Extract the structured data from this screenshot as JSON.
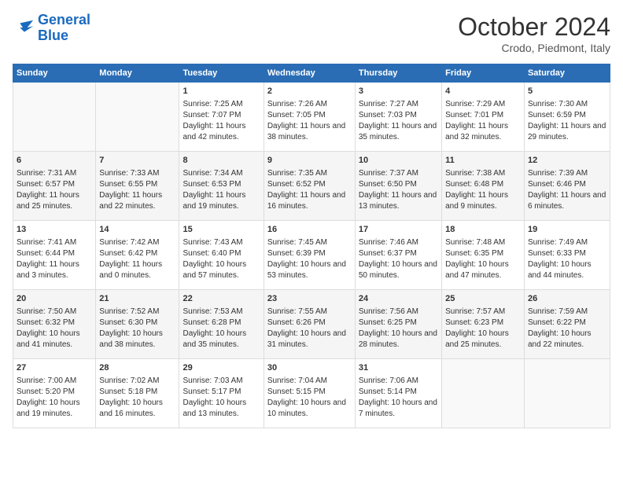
{
  "logo": {
    "line1": "General",
    "line2": "Blue"
  },
  "title": "October 2024",
  "location": "Crodo, Piedmont, Italy",
  "days_of_week": [
    "Sunday",
    "Monday",
    "Tuesday",
    "Wednesday",
    "Thursday",
    "Friday",
    "Saturday"
  ],
  "weeks": [
    [
      {
        "day": "",
        "info": ""
      },
      {
        "day": "",
        "info": ""
      },
      {
        "day": "1",
        "info": "Sunrise: 7:25 AM\nSunset: 7:07 PM\nDaylight: 11 hours and 42 minutes."
      },
      {
        "day": "2",
        "info": "Sunrise: 7:26 AM\nSunset: 7:05 PM\nDaylight: 11 hours and 38 minutes."
      },
      {
        "day": "3",
        "info": "Sunrise: 7:27 AM\nSunset: 7:03 PM\nDaylight: 11 hours and 35 minutes."
      },
      {
        "day": "4",
        "info": "Sunrise: 7:29 AM\nSunset: 7:01 PM\nDaylight: 11 hours and 32 minutes."
      },
      {
        "day": "5",
        "info": "Sunrise: 7:30 AM\nSunset: 6:59 PM\nDaylight: 11 hours and 29 minutes."
      }
    ],
    [
      {
        "day": "6",
        "info": "Sunrise: 7:31 AM\nSunset: 6:57 PM\nDaylight: 11 hours and 25 minutes."
      },
      {
        "day": "7",
        "info": "Sunrise: 7:33 AM\nSunset: 6:55 PM\nDaylight: 11 hours and 22 minutes."
      },
      {
        "day": "8",
        "info": "Sunrise: 7:34 AM\nSunset: 6:53 PM\nDaylight: 11 hours and 19 minutes."
      },
      {
        "day": "9",
        "info": "Sunrise: 7:35 AM\nSunset: 6:52 PM\nDaylight: 11 hours and 16 minutes."
      },
      {
        "day": "10",
        "info": "Sunrise: 7:37 AM\nSunset: 6:50 PM\nDaylight: 11 hours and 13 minutes."
      },
      {
        "day": "11",
        "info": "Sunrise: 7:38 AM\nSunset: 6:48 PM\nDaylight: 11 hours and 9 minutes."
      },
      {
        "day": "12",
        "info": "Sunrise: 7:39 AM\nSunset: 6:46 PM\nDaylight: 11 hours and 6 minutes."
      }
    ],
    [
      {
        "day": "13",
        "info": "Sunrise: 7:41 AM\nSunset: 6:44 PM\nDaylight: 11 hours and 3 minutes."
      },
      {
        "day": "14",
        "info": "Sunrise: 7:42 AM\nSunset: 6:42 PM\nDaylight: 11 hours and 0 minutes."
      },
      {
        "day": "15",
        "info": "Sunrise: 7:43 AM\nSunset: 6:40 PM\nDaylight: 10 hours and 57 minutes."
      },
      {
        "day": "16",
        "info": "Sunrise: 7:45 AM\nSunset: 6:39 PM\nDaylight: 10 hours and 53 minutes."
      },
      {
        "day": "17",
        "info": "Sunrise: 7:46 AM\nSunset: 6:37 PM\nDaylight: 10 hours and 50 minutes."
      },
      {
        "day": "18",
        "info": "Sunrise: 7:48 AM\nSunset: 6:35 PM\nDaylight: 10 hours and 47 minutes."
      },
      {
        "day": "19",
        "info": "Sunrise: 7:49 AM\nSunset: 6:33 PM\nDaylight: 10 hours and 44 minutes."
      }
    ],
    [
      {
        "day": "20",
        "info": "Sunrise: 7:50 AM\nSunset: 6:32 PM\nDaylight: 10 hours and 41 minutes."
      },
      {
        "day": "21",
        "info": "Sunrise: 7:52 AM\nSunset: 6:30 PM\nDaylight: 10 hours and 38 minutes."
      },
      {
        "day": "22",
        "info": "Sunrise: 7:53 AM\nSunset: 6:28 PM\nDaylight: 10 hours and 35 minutes."
      },
      {
        "day": "23",
        "info": "Sunrise: 7:55 AM\nSunset: 6:26 PM\nDaylight: 10 hours and 31 minutes."
      },
      {
        "day": "24",
        "info": "Sunrise: 7:56 AM\nSunset: 6:25 PM\nDaylight: 10 hours and 28 minutes."
      },
      {
        "day": "25",
        "info": "Sunrise: 7:57 AM\nSunset: 6:23 PM\nDaylight: 10 hours and 25 minutes."
      },
      {
        "day": "26",
        "info": "Sunrise: 7:59 AM\nSunset: 6:22 PM\nDaylight: 10 hours and 22 minutes."
      }
    ],
    [
      {
        "day": "27",
        "info": "Sunrise: 7:00 AM\nSunset: 5:20 PM\nDaylight: 10 hours and 19 minutes."
      },
      {
        "day": "28",
        "info": "Sunrise: 7:02 AM\nSunset: 5:18 PM\nDaylight: 10 hours and 16 minutes."
      },
      {
        "day": "29",
        "info": "Sunrise: 7:03 AM\nSunset: 5:17 PM\nDaylight: 10 hours and 13 minutes."
      },
      {
        "day": "30",
        "info": "Sunrise: 7:04 AM\nSunset: 5:15 PM\nDaylight: 10 hours and 10 minutes."
      },
      {
        "day": "31",
        "info": "Sunrise: 7:06 AM\nSunset: 5:14 PM\nDaylight: 10 hours and 7 minutes."
      },
      {
        "day": "",
        "info": ""
      },
      {
        "day": "",
        "info": ""
      }
    ]
  ]
}
